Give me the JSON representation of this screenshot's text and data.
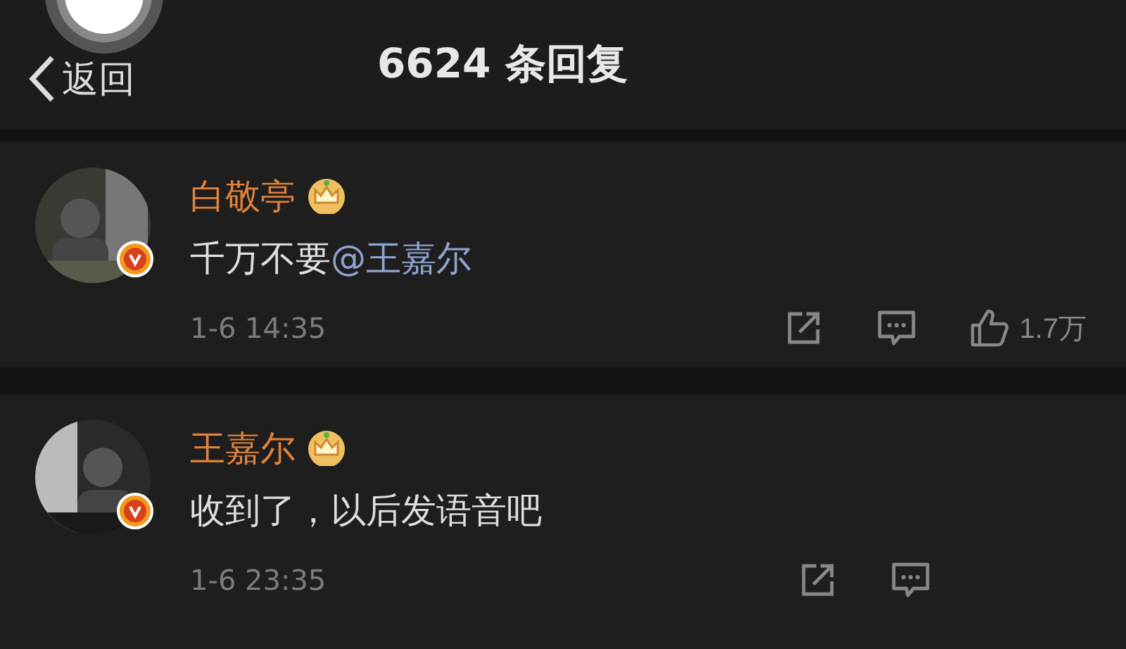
{
  "header": {
    "back": "返回",
    "title": "6624 条回复"
  },
  "comments": [
    {
      "author": "白敬亭",
      "crown": true,
      "verified": true,
      "parts": [
        {
          "kind": "text",
          "text": "千万不要"
        },
        {
          "kind": "mention",
          "text": "@王嘉尔"
        }
      ],
      "time": "1-6 14:35",
      "likes": "1.7万"
    },
    {
      "author": "王嘉尔",
      "crown": true,
      "verified": true,
      "parts": [
        {
          "kind": "text",
          "text": "收到了，以后发语音吧"
        }
      ],
      "time": "1-6 23:35"
    }
  ]
}
